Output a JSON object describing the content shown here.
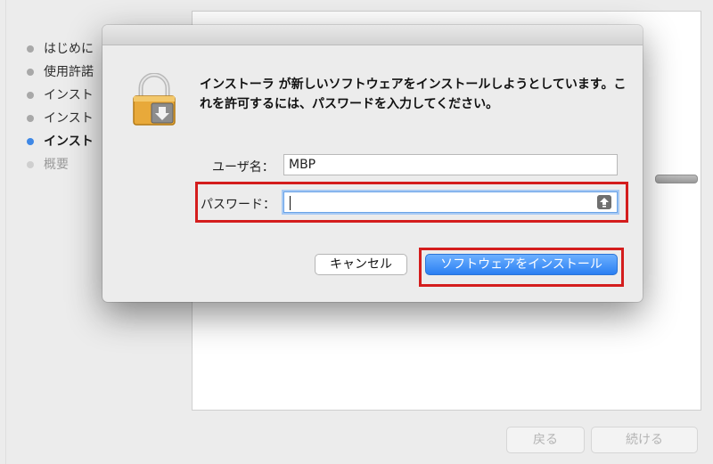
{
  "installer": {
    "steps": [
      {
        "label": "はじめに",
        "state": "done"
      },
      {
        "label": "使用許諾",
        "state": "done"
      },
      {
        "label": "インスト",
        "state": "done"
      },
      {
        "label": "インスト",
        "state": "done"
      },
      {
        "label": "インスト",
        "state": "active"
      },
      {
        "label": "概要",
        "state": "disabled"
      }
    ],
    "back_label": "戻る",
    "continue_label": "続ける"
  },
  "dialog": {
    "message": "インストーラ が新しいソフトウェアをインストールしようとしています。これを許可するには、パスワードを入力してください。",
    "username_label": "ユーザ名：",
    "username_value": "MBP",
    "password_label": "パスワード：",
    "password_value": "",
    "cancel_label": "キャンセル",
    "install_label": "ソフトウェアをインストール"
  },
  "icons": {
    "lock": "lock-icon",
    "capslock": "capslock-icon"
  },
  "colors": {
    "accent": "#2a7ff2",
    "active_step": "#3f88e6",
    "highlight": "#d41d1d"
  }
}
